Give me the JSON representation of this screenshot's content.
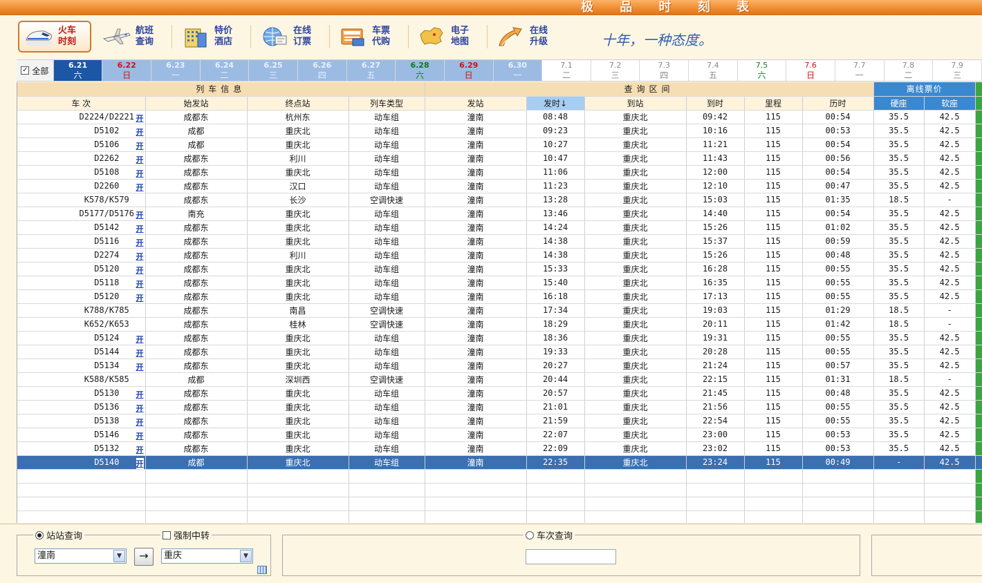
{
  "title": "极 品 时 刻 表",
  "toolbar": {
    "buttons": [
      {
        "label": "火车\n时刻",
        "icon": "train-icon"
      },
      {
        "label": "航班\n查询",
        "icon": "airplane-icon"
      },
      {
        "label": "特价\n酒店",
        "icon": "hotel-icon"
      },
      {
        "label": "在线\n订票",
        "icon": "globe-ticket-icon"
      },
      {
        "label": "车票\n代购",
        "icon": "ticket-purchase-icon"
      },
      {
        "label": "电子\n地图",
        "icon": "china-map-icon"
      },
      {
        "label": "在线\n升级",
        "icon": "upgrade-arrow-icon"
      }
    ],
    "slogan": "十年，一种态度。"
  },
  "dates": {
    "all_label": "全部",
    "items": [
      {
        "d": "6.21",
        "w": "六",
        "state": "sel"
      },
      {
        "d": "6.22",
        "w": "日",
        "state": "ranged sun"
      },
      {
        "d": "6.23",
        "w": "一",
        "state": "ranged"
      },
      {
        "d": "6.24",
        "w": "二",
        "state": "ranged"
      },
      {
        "d": "6.25",
        "w": "三",
        "state": "ranged"
      },
      {
        "d": "6.26",
        "w": "四",
        "state": "ranged"
      },
      {
        "d": "6.27",
        "w": "五",
        "state": "ranged"
      },
      {
        "d": "6.28",
        "w": "六",
        "state": "ranged sat"
      },
      {
        "d": "6.29",
        "w": "日",
        "state": "ranged sun"
      },
      {
        "d": "6.30",
        "w": "一",
        "state": "ranged"
      },
      {
        "d": "7.1",
        "w": "二",
        "state": "plain"
      },
      {
        "d": "7.2",
        "w": "三",
        "state": "plain"
      },
      {
        "d": "7.3",
        "w": "四",
        "state": "plain"
      },
      {
        "d": "7.4",
        "w": "五",
        "state": "plain"
      },
      {
        "d": "7.5",
        "w": "六",
        "state": "plain sat"
      },
      {
        "d": "7.6",
        "w": "日",
        "state": "plain sun"
      },
      {
        "d": "7.7",
        "w": "一",
        "state": "plain"
      },
      {
        "d": "7.8",
        "w": "二",
        "state": "plain"
      },
      {
        "d": "7.9",
        "w": "三",
        "state": "plain"
      }
    ]
  },
  "table": {
    "group_train": "列车信息",
    "group_query": "查询区间",
    "group_price": "离线票价",
    "headers": [
      "车 次",
      "始发站",
      "终点站",
      "列车类型",
      "发站",
      "发时↓",
      "到站",
      "到时",
      "里程",
      "历时",
      "硬座",
      "软座"
    ],
    "open_label": "开",
    "rows": [
      [
        "D2224/D2221",
        "成都东",
        "杭州东",
        "动车组",
        "潼南",
        "08:48",
        "重庆北",
        "09:42",
        "115",
        "00:54",
        "35.5",
        "42.5",
        true
      ],
      [
        "D5102",
        "成都",
        "重庆北",
        "动车组",
        "潼南",
        "09:23",
        "重庆北",
        "10:16",
        "115",
        "00:53",
        "35.5",
        "42.5",
        true
      ],
      [
        "D5106",
        "成都",
        "重庆北",
        "动车组",
        "潼南",
        "10:27",
        "重庆北",
        "11:21",
        "115",
        "00:54",
        "35.5",
        "42.5",
        true
      ],
      [
        "D2262",
        "成都东",
        "利川",
        "动车组",
        "潼南",
        "10:47",
        "重庆北",
        "11:43",
        "115",
        "00:56",
        "35.5",
        "42.5",
        true
      ],
      [
        "D5108",
        "成都东",
        "重庆北",
        "动车组",
        "潼南",
        "11:06",
        "重庆北",
        "12:00",
        "115",
        "00:54",
        "35.5",
        "42.5",
        true
      ],
      [
        "D2260",
        "成都东",
        "汉口",
        "动车组",
        "潼南",
        "11:23",
        "重庆北",
        "12:10",
        "115",
        "00:47",
        "35.5",
        "42.5",
        true
      ],
      [
        "K578/K579",
        "成都东",
        "长沙",
        "空调快速",
        "潼南",
        "13:28",
        "重庆北",
        "15:03",
        "115",
        "01:35",
        "18.5",
        "-",
        false
      ],
      [
        "D5177/D5176",
        "南充",
        "重庆北",
        "动车组",
        "潼南",
        "13:46",
        "重庆北",
        "14:40",
        "115",
        "00:54",
        "35.5",
        "42.5",
        true
      ],
      [
        "D5142",
        "成都东",
        "重庆北",
        "动车组",
        "潼南",
        "14:24",
        "重庆北",
        "15:26",
        "115",
        "01:02",
        "35.5",
        "42.5",
        true
      ],
      [
        "D5116",
        "成都东",
        "重庆北",
        "动车组",
        "潼南",
        "14:38",
        "重庆北",
        "15:37",
        "115",
        "00:59",
        "35.5",
        "42.5",
        true
      ],
      [
        "D2274",
        "成都东",
        "利川",
        "动车组",
        "潼南",
        "14:38",
        "重庆北",
        "15:26",
        "115",
        "00:48",
        "35.5",
        "42.5",
        true
      ],
      [
        "D5120",
        "成都东",
        "重庆北",
        "动车组",
        "潼南",
        "15:33",
        "重庆北",
        "16:28",
        "115",
        "00:55",
        "35.5",
        "42.5",
        true
      ],
      [
        "D5118",
        "成都东",
        "重庆北",
        "动车组",
        "潼南",
        "15:40",
        "重庆北",
        "16:35",
        "115",
        "00:55",
        "35.5",
        "42.5",
        true
      ],
      [
        "D5120",
        "成都东",
        "重庆北",
        "动车组",
        "潼南",
        "16:18",
        "重庆北",
        "17:13",
        "115",
        "00:55",
        "35.5",
        "42.5",
        true
      ],
      [
        "K788/K785",
        "成都东",
        "南昌",
        "空调快速",
        "潼南",
        "17:34",
        "重庆北",
        "19:03",
        "115",
        "01:29",
        "18.5",
        "-",
        false
      ],
      [
        "K652/K653",
        "成都东",
        "桂林",
        "空调快速",
        "潼南",
        "18:29",
        "重庆北",
        "20:11",
        "115",
        "01:42",
        "18.5",
        "-",
        false
      ],
      [
        "D5124",
        "成都东",
        "重庆北",
        "动车组",
        "潼南",
        "18:36",
        "重庆北",
        "19:31",
        "115",
        "00:55",
        "35.5",
        "42.5",
        true
      ],
      [
        "D5144",
        "成都东",
        "重庆北",
        "动车组",
        "潼南",
        "19:33",
        "重庆北",
        "20:28",
        "115",
        "00:55",
        "35.5",
        "42.5",
        true
      ],
      [
        "D5134",
        "成都东",
        "重庆北",
        "动车组",
        "潼南",
        "20:27",
        "重庆北",
        "21:24",
        "115",
        "00:57",
        "35.5",
        "42.5",
        true
      ],
      [
        "K588/K585",
        "成都",
        "深圳西",
        "空调快速",
        "潼南",
        "20:44",
        "重庆北",
        "22:15",
        "115",
        "01:31",
        "18.5",
        "-",
        false
      ],
      [
        "D5130",
        "成都东",
        "重庆北",
        "动车组",
        "潼南",
        "20:57",
        "重庆北",
        "21:45",
        "115",
        "00:48",
        "35.5",
        "42.5",
        true
      ],
      [
        "D5136",
        "成都东",
        "重庆北",
        "动车组",
        "潼南",
        "21:01",
        "重庆北",
        "21:56",
        "115",
        "00:55",
        "35.5",
        "42.5",
        true
      ],
      [
        "D5138",
        "成都东",
        "重庆北",
        "动车组",
        "潼南",
        "21:59",
        "重庆北",
        "22:54",
        "115",
        "00:55",
        "35.5",
        "42.5",
        true
      ],
      [
        "D5146",
        "成都东",
        "重庆北",
        "动车组",
        "潼南",
        "22:07",
        "重庆北",
        "23:00",
        "115",
        "00:53",
        "35.5",
        "42.5",
        true
      ],
      [
        "D5132",
        "成都东",
        "重庆北",
        "动车组",
        "潼南",
        "22:09",
        "重庆北",
        "23:02",
        "115",
        "00:53",
        "35.5",
        "42.5",
        true
      ],
      [
        "D5140",
        "成都",
        "重庆北",
        "动车组",
        "潼南",
        "22:35",
        "重庆北",
        "23:24",
        "115",
        "00:49",
        "-",
        "42.5",
        true
      ]
    ],
    "selected_row": 25
  },
  "query": {
    "station_mode_label": "站站查询",
    "transfer_label": "强制中转",
    "from_value": "潼南",
    "to_value": "重庆",
    "go_symbol": "→",
    "train_mode_label": "车次查询",
    "train_value": ""
  }
}
